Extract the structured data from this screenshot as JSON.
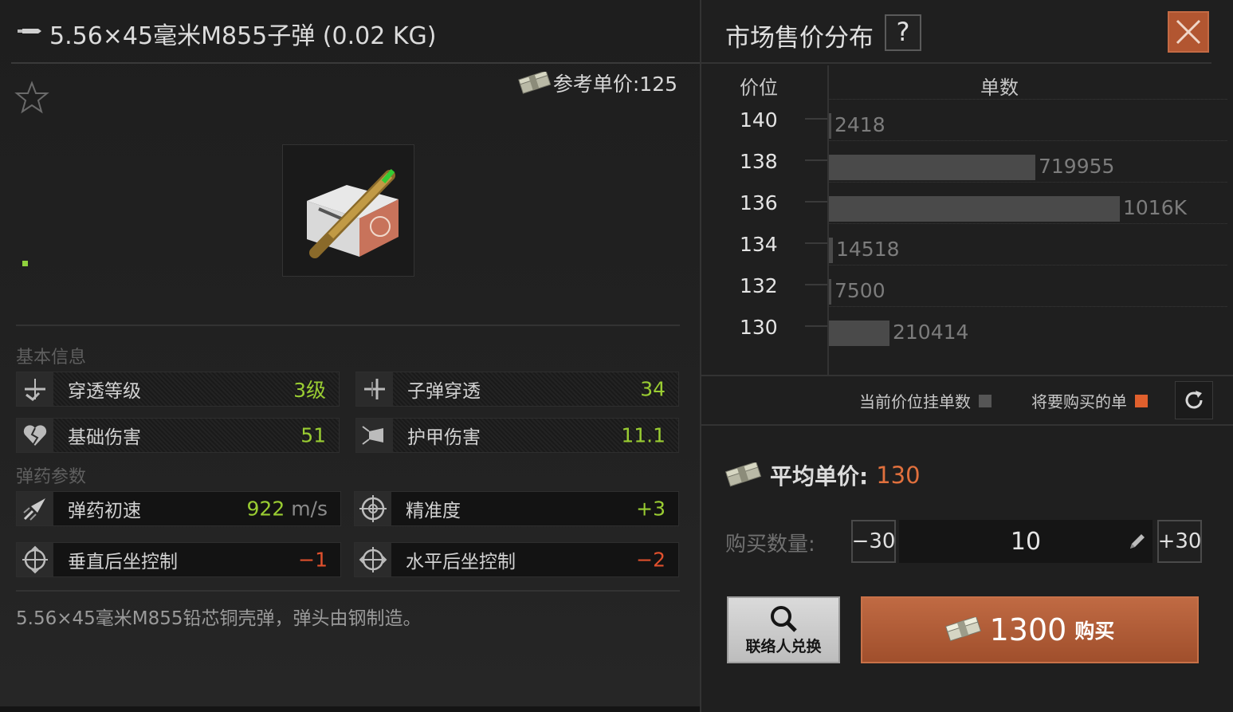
{
  "item": {
    "title": "5.56×45毫米M855子弹 (0.02 KG)",
    "reference_price": "参考单价:125",
    "description": "5.56×45毫米M855铅芯铜壳弹，弹头由钢制造。"
  },
  "sections": {
    "basic": "基本信息",
    "ammo": "弹药参数"
  },
  "stats": {
    "penetration_level": {
      "label": "穿透等级",
      "value": "3级"
    },
    "bullet_penetration": {
      "label": "子弹穿透",
      "value": "34"
    },
    "base_damage": {
      "label": "基础伤害",
      "value": "51"
    },
    "armor_damage": {
      "label": "护甲伤害",
      "value": "11.1"
    },
    "muzzle_velocity": {
      "label": "弹药初速",
      "value": "922",
      "unit": "m/s"
    },
    "accuracy": {
      "label": "精准度",
      "value": "+3"
    },
    "vertical_recoil": {
      "label": "垂直后坐控制",
      "value": "−1"
    },
    "horizontal_recoil": {
      "label": "水平后坐控制",
      "value": "−2"
    }
  },
  "market": {
    "title": "市场售价分布",
    "help": "?",
    "price_header": "价位",
    "qty_header": "单数",
    "legend_current": "当前价位挂单数",
    "legend_buy": "将要购买的单",
    "avg_label": "平均单价:",
    "avg_value": "130",
    "qty_label": "购买数量:",
    "minus": "−30",
    "plus": "+30",
    "quantity": "10",
    "contact_exchange": "联络人兑换",
    "buy_amount": "1300",
    "buy_label": "购买"
  },
  "colors": {
    "accent": "#b25631",
    "price_orange": "#e0703d",
    "stat_green": "#9acd32",
    "stat_red": "#e0502d"
  },
  "chart_data": {
    "type": "bar",
    "orientation": "horizontal",
    "price_ticks": [
      "140",
      "138",
      "136",
      "134",
      "132",
      "130"
    ],
    "categories": [
      "140",
      "138",
      "136",
      "134",
      "132",
      "130"
    ],
    "values": [
      2418,
      719955,
      1016000,
      14518,
      7500,
      210414
    ],
    "data_labels": [
      "2418",
      "719955",
      "1016K",
      "14518",
      "7500",
      "210414"
    ]
  }
}
